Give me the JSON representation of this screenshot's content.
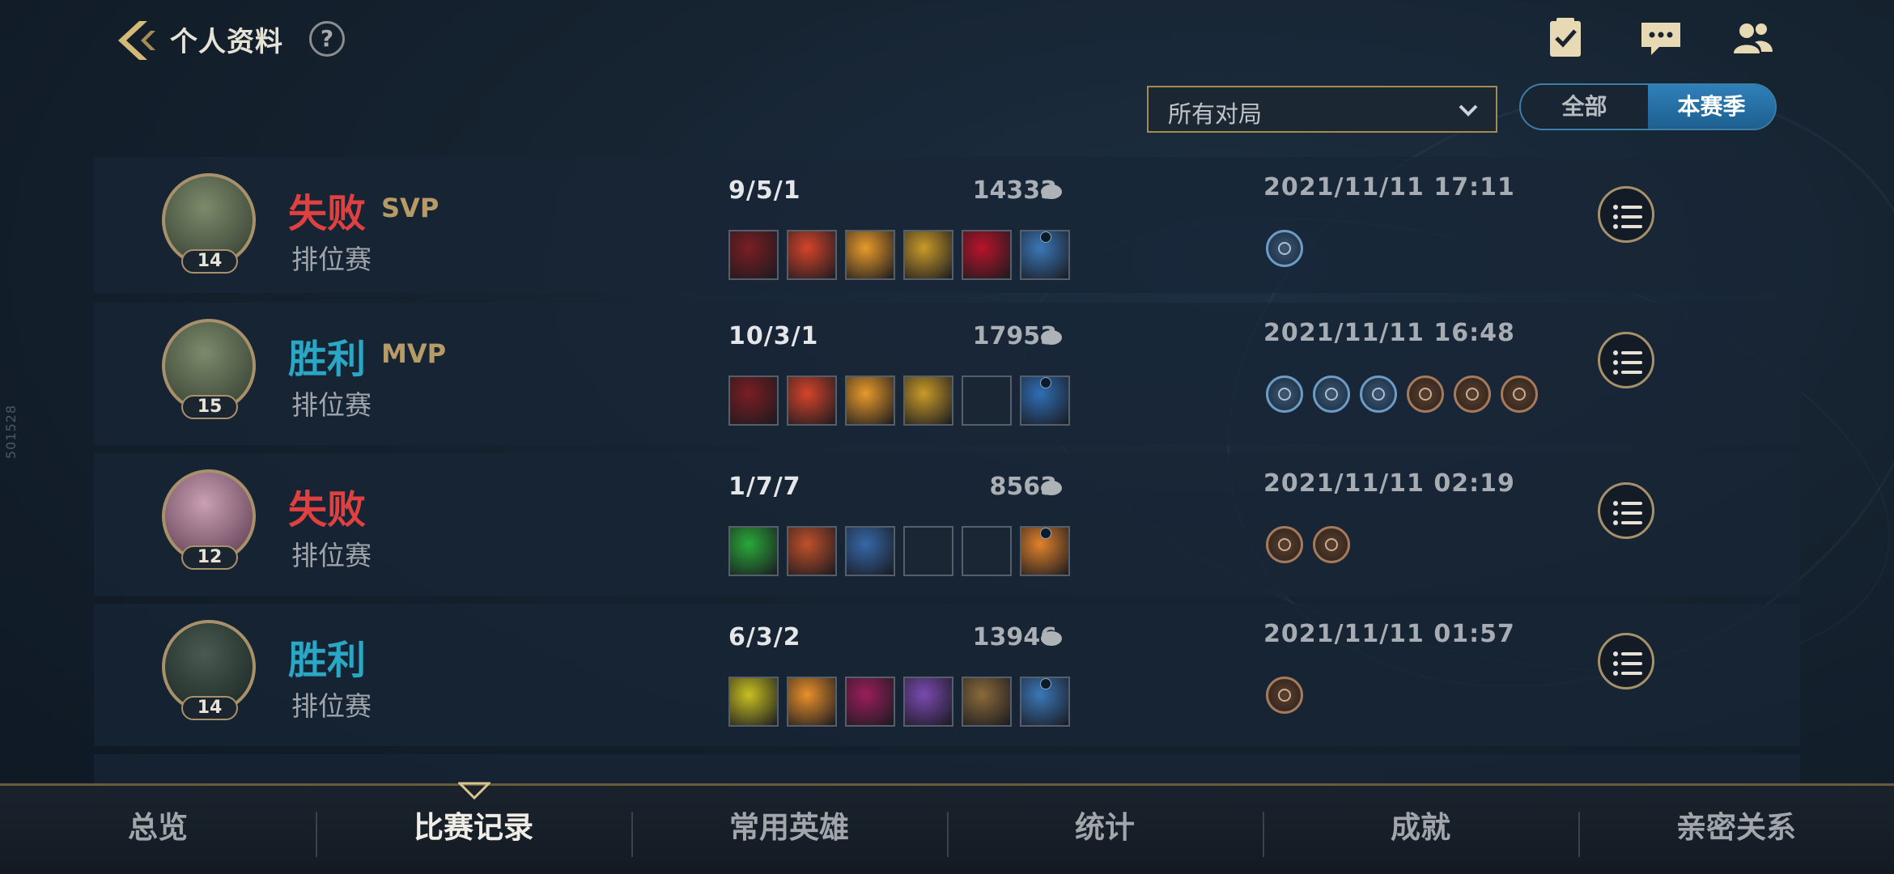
{
  "header": {
    "title": "个人资料",
    "help": "?",
    "side_code": "501528"
  },
  "filters": {
    "match_select": "所有对局",
    "segments": [
      "全部",
      "本赛季"
    ],
    "active_segment": "本赛季"
  },
  "matches": [
    {
      "result": "失败",
      "badge": "SVP",
      "mode": "排位赛",
      "level": "14",
      "kda": "9/5/1",
      "gold": "14333",
      "date": "2021/11/11 17:11",
      "medals": [
        "blue"
      ]
    },
    {
      "result": "胜利",
      "badge": "MVP",
      "mode": "排位赛",
      "level": "15",
      "kda": "10/3/1",
      "gold": "17953",
      "date": "2021/11/11 16:48",
      "medals": [
        "blue",
        "blue",
        "blue",
        "bronze",
        "bronze",
        "bronze"
      ]
    },
    {
      "result": "失败",
      "badge": "",
      "mode": "排位赛",
      "level": "12",
      "kda": "1/7/7",
      "gold": "8563",
      "date": "2021/11/11 02:19",
      "medals": [
        "bronze",
        "bronze"
      ]
    },
    {
      "result": "胜利",
      "badge": "",
      "mode": "排位赛",
      "level": "14",
      "kda": "6/3/2",
      "gold": "13946",
      "date": "2021/11/11 01:57",
      "medals": [
        "bronze"
      ]
    }
  ],
  "nav": {
    "tabs": [
      "总览",
      "比赛记录",
      "常用英雄",
      "统计",
      "成就",
      "亲密关系"
    ],
    "active": "比赛记录"
  },
  "colors": {
    "lose": "#e04040",
    "win": "#2aa7c4",
    "gold_accent": "#a8916a",
    "active_segment": "#2f80b9"
  }
}
